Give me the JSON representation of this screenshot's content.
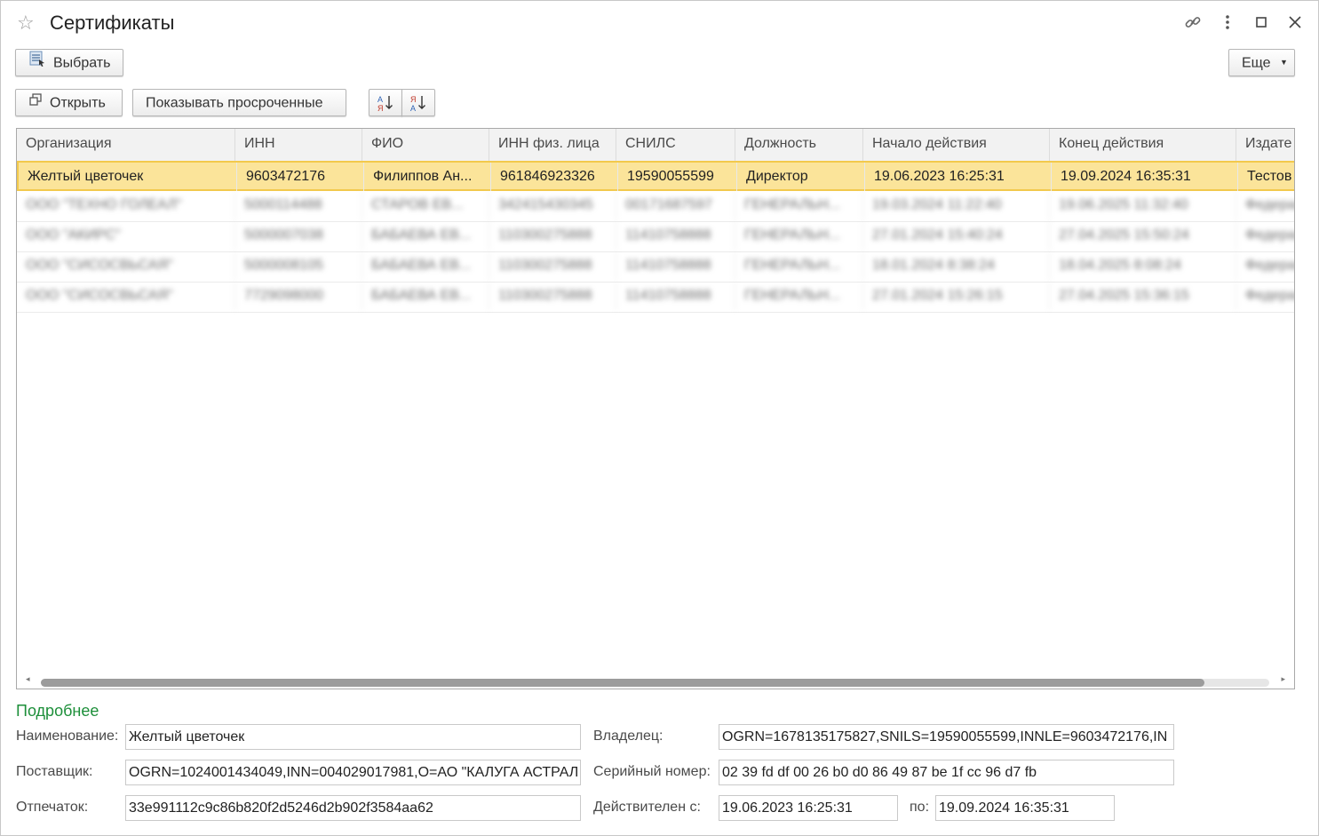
{
  "window": {
    "title": "Сертификаты"
  },
  "toolbar": {
    "select_label": "Выбрать",
    "more_label": "Еще",
    "open_label": "Открыть",
    "show_expired_label": "Показывать просроченные"
  },
  "grid": {
    "columns": [
      "Организация",
      "ИНН",
      "ФИО",
      "ИНН физ. лица",
      "СНИЛС",
      "Должность",
      "Начало действия",
      "Конец действия",
      "Издате"
    ],
    "selected_row": [
      "Желтый цветочек",
      "9603472176",
      "Филиппов Ан...",
      "961846923326",
      "19590055599",
      "Директор",
      "19.06.2023 16:25:31",
      "19.09.2024 16:35:31",
      "Тестов"
    ],
    "blurred_rows": [
      [
        "ООО \"ТЕХНО ГОЛЕАЛ\"",
        "5000114488",
        "СТАРОВ ЕВ...",
        "342415430345",
        "00171687597",
        "ГЕНЕРАЛЬН...",
        "19.03.2024 11:22:40",
        "19.06.2025 11:32:40",
        "Федерал"
      ],
      [
        "ООО \"АКИРС\"",
        "5000007038",
        "БАБАЕВА ЕВ...",
        "110300275888",
        "11410758888",
        "ГЕНЕРАЛЬН...",
        "27.01.2024 15:40:24",
        "27.04.2025 15:50:24",
        "Федерал"
      ],
      [
        "ООО \"СИСОСВЬСАЯ\"",
        "5000008105",
        "БАБАЕВА ЕВ...",
        "110300275888",
        "11410758888",
        "ГЕНЕРАЛЬН...",
        "18.01.2024 8:38:24",
        "18.04.2025 8:08:24",
        "Федерал"
      ],
      [
        "ООО \"СИСОСВЬСАЯ\"",
        "7729098000",
        "БАБАЕВА ЕВ...",
        "110300275888",
        "11410758888",
        "ГЕНЕРАЛЬН...",
        "27.01.2024 15:26:15",
        "27.04.2025 15:36:15",
        "Федерал"
      ]
    ]
  },
  "details": {
    "title": "Подробнее",
    "name_label": "Наименование:",
    "name_value": "Желтый цветочек",
    "owner_label": "Владелец:",
    "owner_value": "OGRN=1678135175827,SNILS=19590055599,INNLE=9603472176,IN",
    "supplier_label": "Поставщик:",
    "supplier_value": "OGRN=1024001434049,INN=004029017981,O=АО \"КАЛУГА АСТРАЛ",
    "serial_label": "Серийный номер:",
    "serial_value": "02 39 fd df 00 26 b0 d0 86 49 87 be 1f cc 96 d7 fb",
    "thumbprint_label": "Отпечаток:",
    "thumbprint_value": "33e991112c9c86b820f2d5246d2b902f3584aa62",
    "valid_from_label": "Действителен с:",
    "valid_from_value": "19.06.2023 16:25:31",
    "valid_to_label": "по:",
    "valid_to_value": "19.09.2024 16:35:31"
  }
}
